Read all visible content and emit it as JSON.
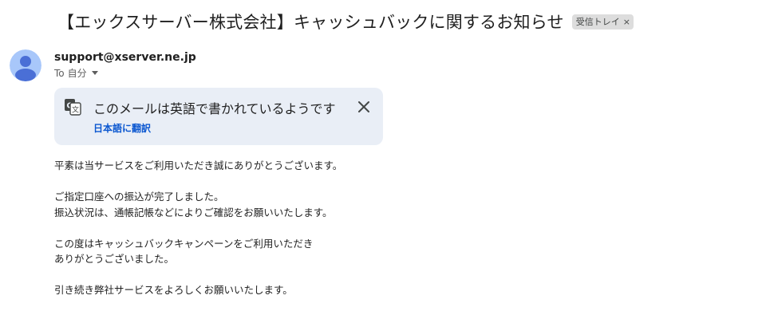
{
  "subject": "【エックスサーバー株式会社】キャッシュバックに関するお知らせ",
  "label_chip": {
    "text": "受信トレイ",
    "remove_glyph": "×"
  },
  "sender": {
    "email": "support@xserver.ne.jp",
    "avatar_icon": "person-avatar-icon",
    "avatar_bg": "#a8c7fa",
    "avatar_fg": "#4a6fd6"
  },
  "recipients": {
    "to_label": "To",
    "to_value": "自分",
    "expand_icon": "caret-down-icon"
  },
  "translation_bar": {
    "icon": "translate-icon",
    "message": "このメールは英語で書かれているようです",
    "action_label": "日本語に翻訳",
    "close_icon": "close-icon",
    "bg": "#e9eef6",
    "link_color": "#0b57d0"
  },
  "body": {
    "lines": [
      "平素は当サービスをご利用いただき誠にありがとうございます。",
      "",
      "ご指定口座への振込が完了しました。",
      "振込状況は、通帳記帳などによりご確認をお願いいたします。",
      "",
      "この度はキャッシュバックキャンペーンをご利用いただき",
      "ありがとうございました。",
      "",
      "引き続き弊社サービスをよろしくお願いいたします。"
    ]
  }
}
